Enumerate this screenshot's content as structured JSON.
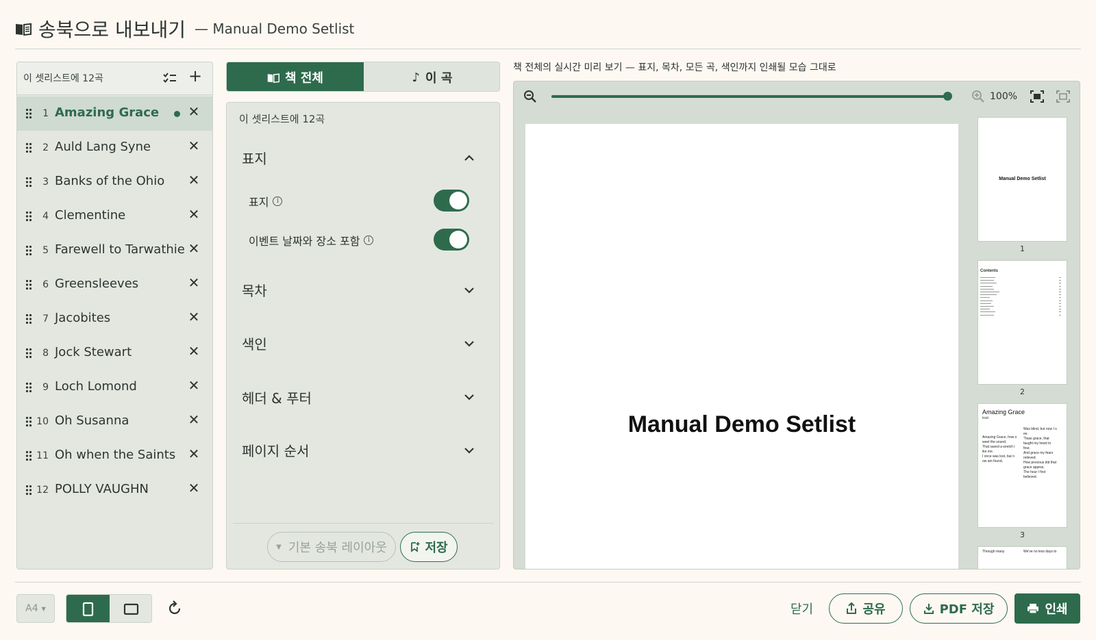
{
  "header": {
    "title": "송북으로 내보내기",
    "subtitle": "— Manual Demo Setlist",
    "icon": "book-open-icon"
  },
  "setlist": {
    "count_label": "이 셋리스트에 12곡",
    "songs": [
      {
        "num": "1",
        "name": "Amazing Grace",
        "active": true
      },
      {
        "num": "2",
        "name": "Auld Lang Syne"
      },
      {
        "num": "3",
        "name": "Banks of the Ohio"
      },
      {
        "num": "4",
        "name": "Clementine"
      },
      {
        "num": "5",
        "name": "Farewell to Tarwathie"
      },
      {
        "num": "6",
        "name": "Greensleeves"
      },
      {
        "num": "7",
        "name": "Jacobites"
      },
      {
        "num": "8",
        "name": "Jock Stewart"
      },
      {
        "num": "9",
        "name": "Loch Lomond"
      },
      {
        "num": "10",
        "name": "Oh Susanna"
      },
      {
        "num": "11",
        "name": "Oh when the Saints"
      },
      {
        "num": "12",
        "name": "POLLY VAUGHN"
      }
    ],
    "remove_glyph": "✕"
  },
  "tabs": {
    "whole_book": "책 전체",
    "this_song": "이 곡"
  },
  "options": {
    "count_label": "이 셋리스트에 12곡",
    "sections": {
      "cover": "표지",
      "toc": "목차",
      "index": "색인",
      "header_footer": "헤더 & 푸터",
      "page_order": "페이지 순서"
    },
    "cover_toggle_label": "표지",
    "event_toggle_label": "이벤트 날짜와 장소 포함",
    "cover_toggle_on": true,
    "event_toggle_on": true,
    "layout_select": "기본 송북 레이아웃",
    "save_label": "저장"
  },
  "preview": {
    "caption": "책 전체의 실시간 미리 보기 — 표지, 목차, 모든 곡, 색인까지 인쇄될 모습 그대로",
    "zoom_level": "100%",
    "zoom_fraction": 1.0,
    "page_title": "Manual Demo Setlist",
    "thumbs": [
      {
        "num": "1",
        "title": "Manual Demo Setlist"
      },
      {
        "num": "2",
        "title": "Contents"
      },
      {
        "num": "3",
        "title": "Amazing Grace",
        "subtitle": "trad."
      }
    ],
    "thumb3_left_lyrics": "Amazing Grace, how s\nweet the sound,\nThat saved a wretch l\nike me.\nI once was lost, but n\now am found,",
    "thumb3_right_lyrics": "Was blind, but now I s\nee.\n'Twas grace, that\ntaught my heart to\nfear,\nAnd grace my fears\nrelieved.\nHow precious did that\ngrace appear,\nThe hour I first\nbelieved.",
    "thumb4_left": "Through many",
    "thumb4_right": "We've no less days to"
  },
  "footer": {
    "paper_size": "A4",
    "close_label": "닫기",
    "share_label": "공유",
    "pdf_label": "PDF 저장",
    "print_label": "인쇄"
  },
  "colors": {
    "accent": "#2e6b4c",
    "background": "#fdf8f2",
    "panel": "#e3e7e0"
  }
}
